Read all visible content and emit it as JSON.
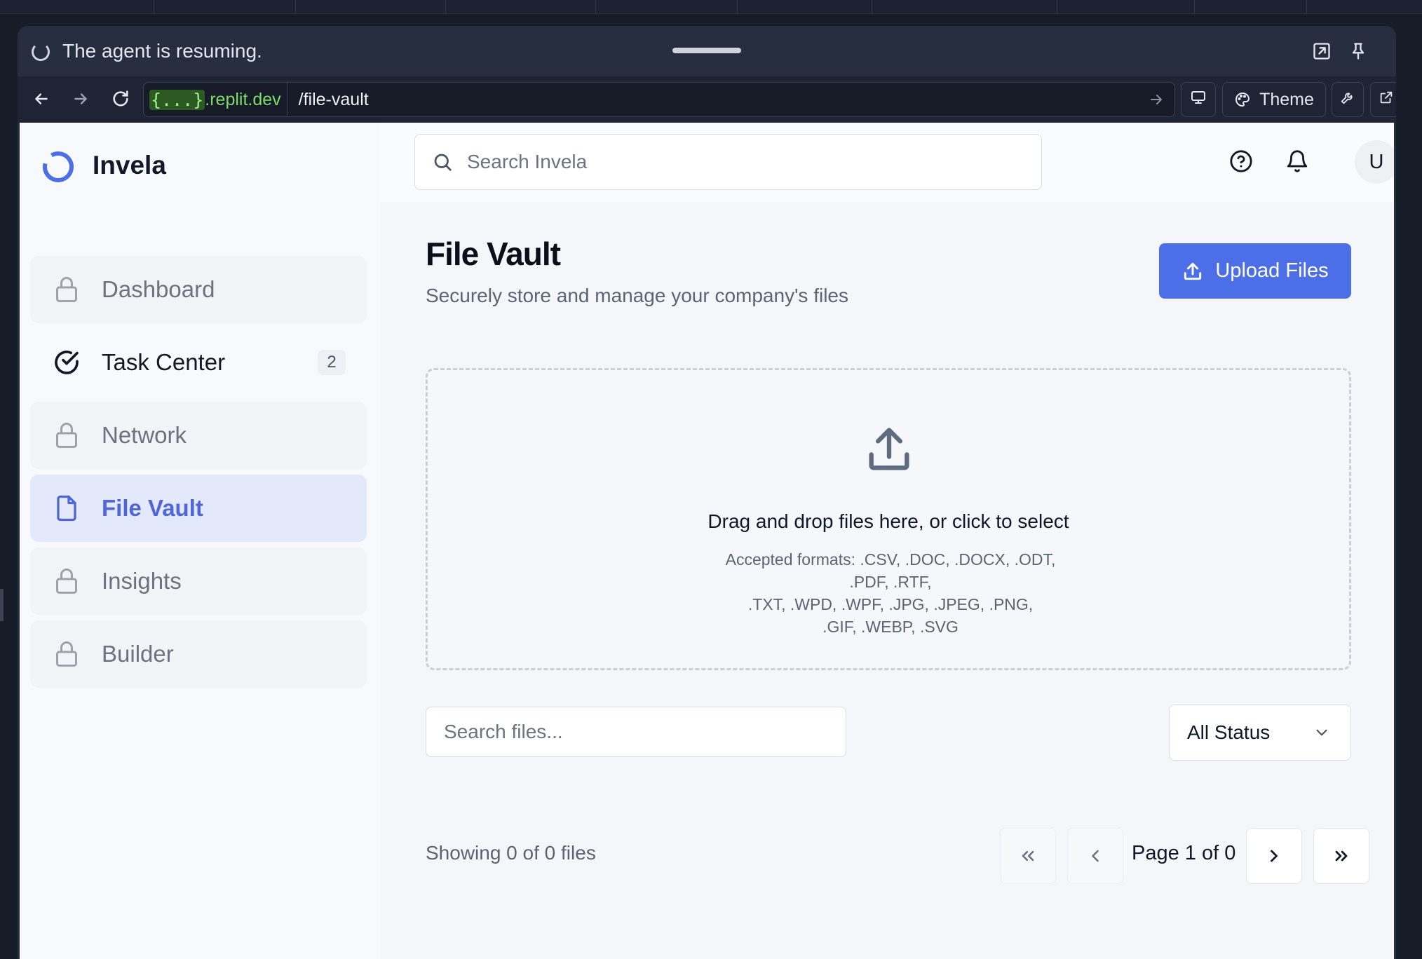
{
  "agent_status": {
    "text": "The agent is resuming."
  },
  "browser": {
    "host_braces": "{...}",
    "host_rest": ".replit.dev",
    "path": "/file-vault",
    "theme_label": "Theme"
  },
  "app": {
    "name": "Invela",
    "search_placeholder": "Search Invela",
    "avatar_letter": "U",
    "accent_color": "#4c6ee6"
  },
  "sidebar": {
    "items": [
      {
        "label": "Dashboard",
        "state": "locked",
        "icon": "lock-icon"
      },
      {
        "label": "Task Center",
        "state": "normal",
        "icon": "check-circle-icon",
        "badge": "2"
      },
      {
        "label": "Network",
        "state": "locked",
        "icon": "lock-icon"
      },
      {
        "label": "File Vault",
        "state": "active",
        "icon": "file-icon"
      },
      {
        "label": "Insights",
        "state": "locked",
        "icon": "lock-icon"
      },
      {
        "label": "Builder",
        "state": "locked",
        "icon": "lock-icon"
      }
    ]
  },
  "page": {
    "title": "File Vault",
    "subtitle": "Securely store and manage your company's files",
    "upload_label": "Upload Files"
  },
  "dropzone": {
    "title": "Drag and drop files here, or click to select",
    "formats_line1": "Accepted formats: .CSV, .DOC, .DOCX, .ODT,",
    "formats_line2": ".PDF, .RTF,",
    "formats_line3": ".TXT, .WPD, .WPF, .JPG, .JPEG, .PNG,",
    "formats_line4": ".GIF, .WEBP, .SVG"
  },
  "filters": {
    "search_placeholder": "Search files...",
    "status_value": "All Status"
  },
  "pagination": {
    "showing": "Showing 0 of 0 files",
    "page_label": "Page 1 of 0"
  }
}
